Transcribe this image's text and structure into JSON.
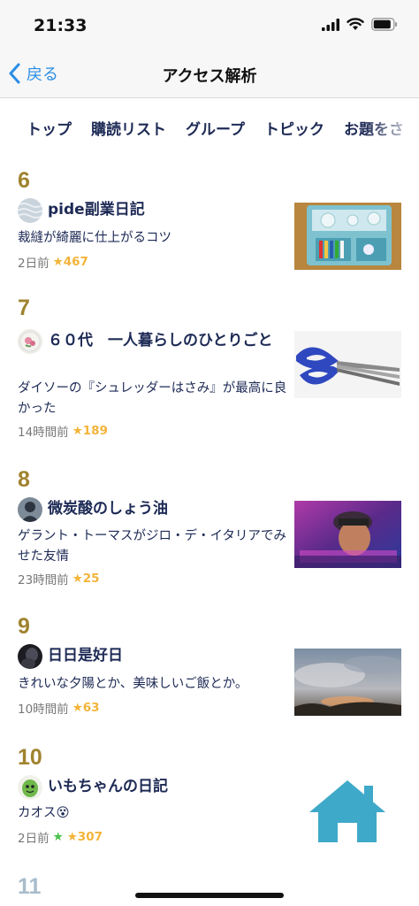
{
  "status_bar": {
    "time": "21:33",
    "icons": [
      "signal-icon",
      "wifi-icon",
      "battery-icon"
    ]
  },
  "nav": {
    "back_label": "戻る",
    "title": "アクセス解析"
  },
  "tabs": [
    "トップ",
    "購読リスト",
    "グループ",
    "トピック",
    "お題をさ"
  ],
  "entries": [
    {
      "rank": "6",
      "blog": "pide副業日記",
      "title": "裁縫が綺麗に仕上がるコツ",
      "time": "2日前",
      "stars": "★467"
    },
    {
      "rank": "7",
      "blog": "６０代　一人暮らしのひとりごと",
      "title": "ダイソーの『シュレッダーはさみ』が最高に良かった",
      "time": "14時間前",
      "stars": "★189"
    },
    {
      "rank": "8",
      "blog": "微炭酸のしょう油",
      "title": "ゲラント・トーマスがジロ・デ・イタリアでみせた友情",
      "time": "23時間前",
      "stars": "★25"
    },
    {
      "rank": "9",
      "blog": "日日是好日",
      "title": "きれいな夕陽とか、美味しいご飯とか。",
      "time": "10時間前",
      "stars": "★63"
    },
    {
      "rank": "10",
      "blog": "いもちゃんの日記",
      "title": "カオス😵",
      "time": "2日前",
      "green_star": "★",
      "stars": "★307"
    },
    {
      "rank": "11"
    }
  ],
  "colors": {
    "accent": "#2a8ee6",
    "rank": "#a0832f",
    "navy": "#1d2a55",
    "star": "#f3b43a",
    "home": "#3fa9c9"
  }
}
